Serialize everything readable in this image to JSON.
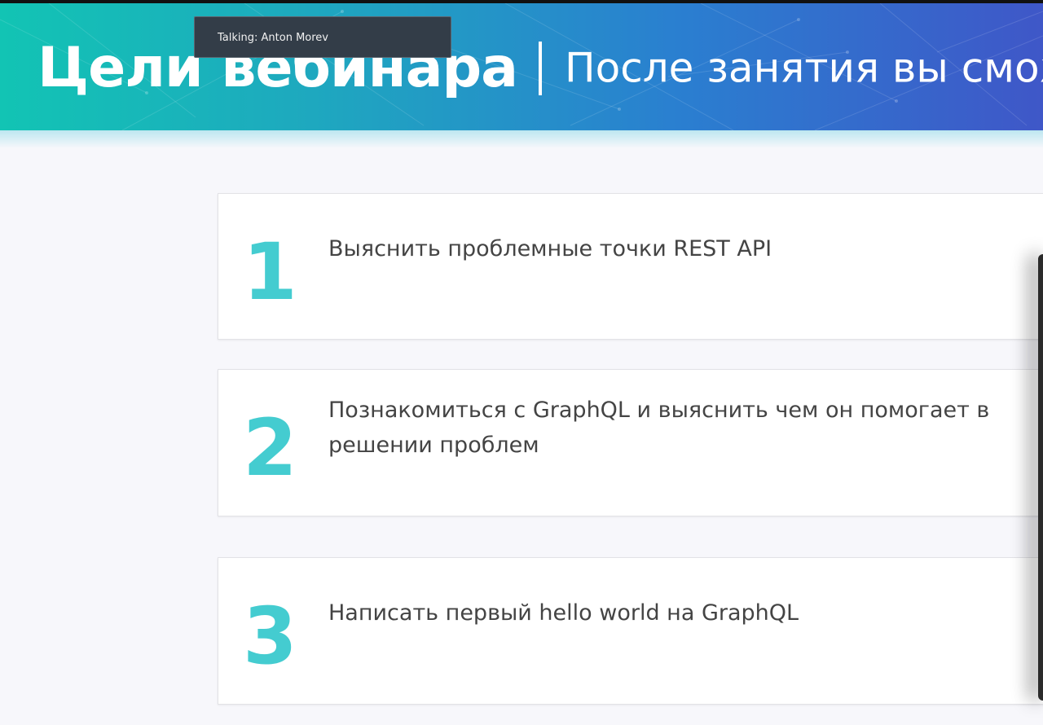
{
  "tooltip": {
    "text": "Talking: Anton Morev"
  },
  "header": {
    "title": "Цели вебинара",
    "subtitle": "После занятия вы смож",
    "gradient_colors": [
      "#12c4b4",
      "#2a7fd0",
      "#3f57c8"
    ]
  },
  "goals": [
    {
      "number": "1",
      "text": "Выяснить проблемные точки REST API"
    },
    {
      "number": "2",
      "text": "Познакомиться с GraphQL и выяснить чем он помогает в решении проблем"
    },
    {
      "number": "3",
      "text": "Написать первый hello world на GraphQL"
    }
  ],
  "colors": {
    "accent_number": "#44ccd0",
    "text": "#444444",
    "background": "#f7f7fb",
    "tooltip_bg": "#333d48"
  }
}
